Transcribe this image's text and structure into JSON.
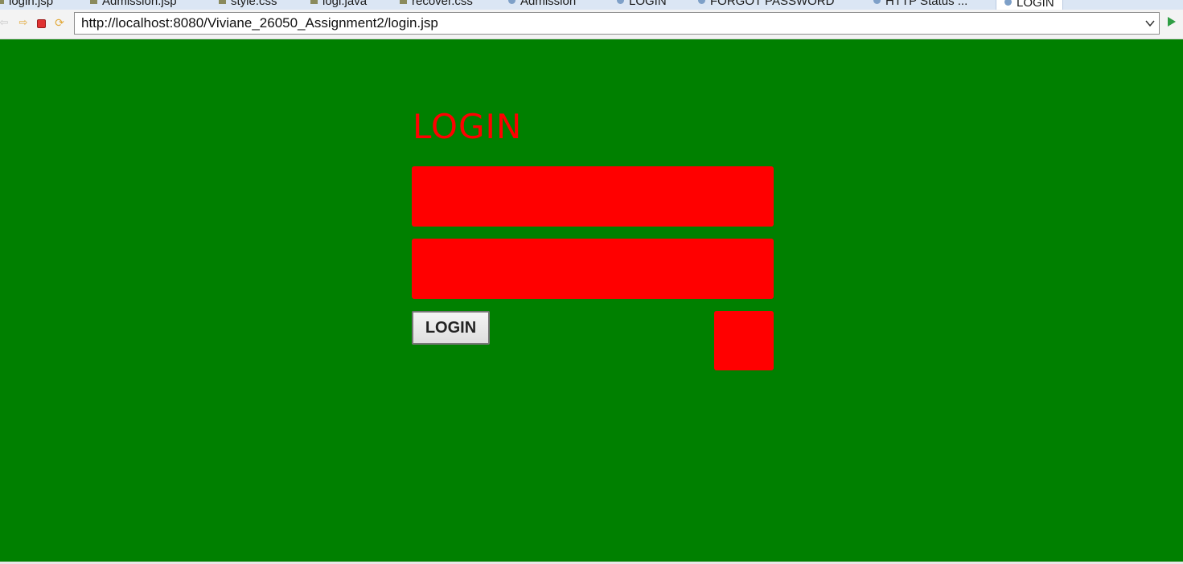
{
  "editor_tabs": [
    {
      "label": "login.jsp",
      "icon": "file-icon"
    },
    {
      "label": "Admission.jsp",
      "icon": "file-icon"
    },
    {
      "label": "style.css",
      "icon": "file-icon"
    },
    {
      "label": "logi.java",
      "icon": "file-icon"
    },
    {
      "label": "recover.css",
      "icon": "file-icon"
    },
    {
      "label": "Admission",
      "icon": "globe-icon"
    },
    {
      "label": "LOGIN",
      "icon": "globe-icon"
    },
    {
      "label": "FORGOT PASSWORD",
      "icon": "globe-icon"
    },
    {
      "label": "HTTP Status ...",
      "icon": "globe-icon"
    },
    {
      "label": "LOGIN",
      "icon": "globe-icon",
      "active": true
    }
  ],
  "browser": {
    "url": "http://localhost:8080/Viviane_26050_Assignment2/login.jsp"
  },
  "page": {
    "title": "LOGIN",
    "login_button_label": "LOGIN"
  },
  "colors": {
    "background": "#008000",
    "accent": "#ff0000"
  }
}
